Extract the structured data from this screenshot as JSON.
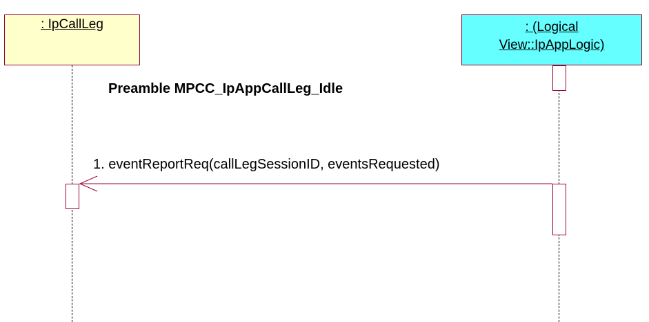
{
  "lifelines": [
    {
      "id": "ipcallleg",
      "label": ": IpCallLeg",
      "fill": "#ffffcc"
    },
    {
      "id": "applogic",
      "label_line1": ": (Logical",
      "label_line2": "View::IpAppLogic)",
      "fill": "#66ffff"
    }
  ],
  "preamble": "Preamble MPCC_IpAppCallLeg_Idle",
  "messages": [
    {
      "label": "1. eventReportReq(callLegSessionID, eventsRequested)",
      "from": "applogic",
      "to": "ipcallleg"
    }
  ],
  "colors": {
    "border": "#990033",
    "lifeline": "#000000"
  }
}
